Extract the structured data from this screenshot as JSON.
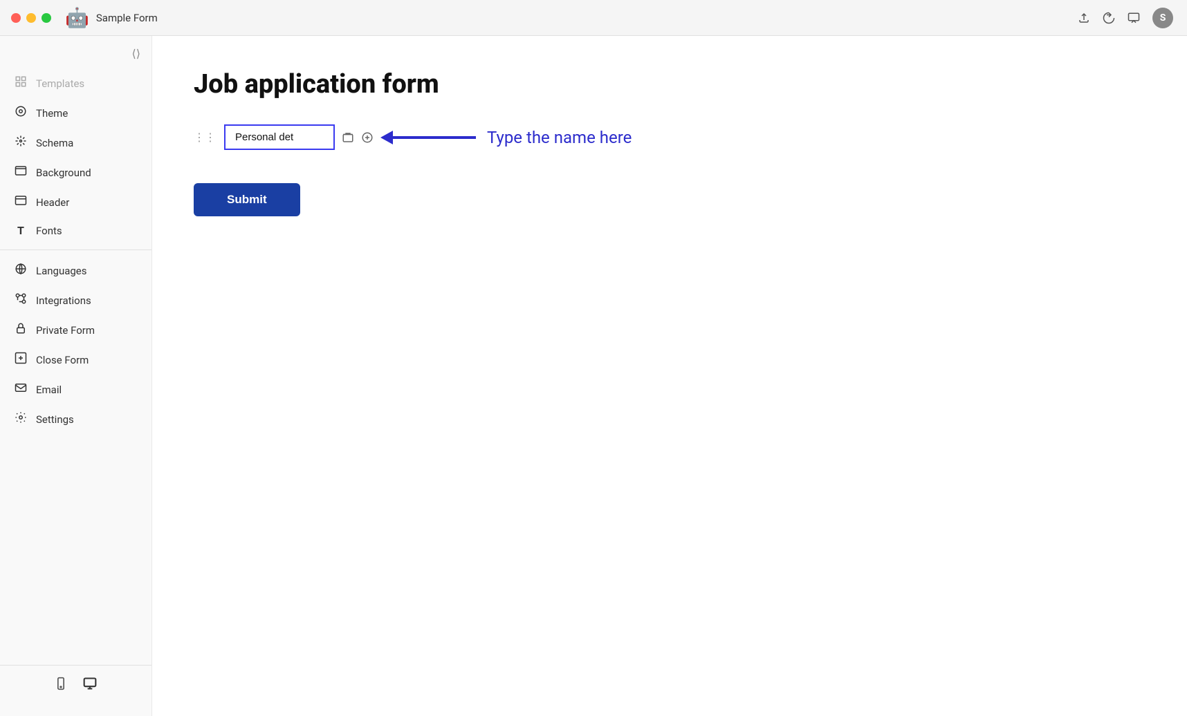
{
  "titlebar": {
    "title": "Sample Form",
    "avatar_letter": "S"
  },
  "sidebar": {
    "collapse_icon": "⟨⟩",
    "items": [
      {
        "id": "templates",
        "label": "Templates",
        "icon": "⊞",
        "disabled": true
      },
      {
        "id": "theme",
        "label": "Theme",
        "icon": "◎"
      },
      {
        "id": "schema",
        "label": "Schema",
        "icon": "✳"
      },
      {
        "id": "background",
        "label": "Background",
        "icon": "⬓"
      },
      {
        "id": "header",
        "label": "Header",
        "icon": "▭"
      },
      {
        "id": "fonts",
        "label": "Fonts",
        "icon": "T"
      },
      {
        "id": "languages",
        "label": "Languages",
        "icon": "🌐"
      },
      {
        "id": "integrations",
        "label": "Integrations",
        "icon": "⚙"
      },
      {
        "id": "private-form",
        "label": "Private Form",
        "icon": "🔒"
      },
      {
        "id": "close-form",
        "label": "Close Form",
        "icon": "⊡"
      },
      {
        "id": "email",
        "label": "Email",
        "icon": "✉"
      },
      {
        "id": "settings",
        "label": "Settings",
        "icon": "⚙"
      }
    ],
    "bottom_icons": [
      "mobile",
      "desktop"
    ]
  },
  "content": {
    "form_title": "Job application form",
    "section_input_value": "Personal det",
    "section_input_placeholder": "Personal det",
    "annotation_text": "Type the name here",
    "submit_button_label": "Submit"
  }
}
